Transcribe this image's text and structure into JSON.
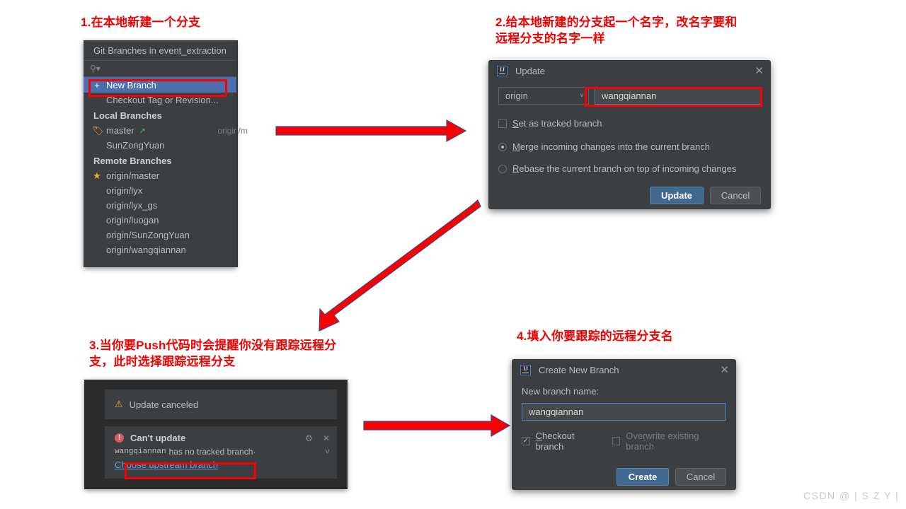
{
  "annotations": [
    {
      "id": "step1",
      "text": "1.在本地新建一个分支"
    },
    {
      "id": "step2",
      "text": "2.给本地新建的分支起一个名字，改名字要和\n远程分支的名字一样"
    },
    {
      "id": "step3",
      "text": "3.当你要Push代码时会提醒你没有跟踪远程分\n支，此时选择跟踪远程分支"
    },
    {
      "id": "step4",
      "text": "4.填入你要跟踪的远程分支名"
    }
  ],
  "git_branches_popup": {
    "title": "Git Branches in event_extraction",
    "search_placeholder": "",
    "search_icon": "search-icon",
    "actions": [
      {
        "label": "New Branch",
        "icon": "plus-icon",
        "selected": true
      },
      {
        "label": "Checkout Tag or Revision...",
        "icon": "",
        "selected": false
      }
    ],
    "local_header": "Local Branches",
    "local_branches": [
      {
        "label": "master",
        "icon": "tag-icon",
        "arrow": "↗",
        "tracked": "origin/m"
      },
      {
        "label": "SunZongYuan",
        "icon": "",
        "arrow": "",
        "tracked": ""
      }
    ],
    "remote_header": "Remote Branches",
    "remote_branches": [
      {
        "label": "origin/master",
        "icon": "star-icon"
      },
      {
        "label": "origin/lyx",
        "icon": ""
      },
      {
        "label": "origin/lyx_gs",
        "icon": ""
      },
      {
        "label": "origin/luogan",
        "icon": ""
      },
      {
        "label": "origin/SunZongYuan",
        "icon": ""
      },
      {
        "label": "origin/wangqiannan",
        "icon": ""
      }
    ]
  },
  "update_dialog": {
    "title": "Update",
    "app_icon": "intellij-idea-icon",
    "close_icon": "close-icon",
    "remote_value": "origin",
    "branch_value": "wangqiannan",
    "set_tracked_label": "Set as tracked branch",
    "set_tracked_checked": false,
    "merge_label": "Merge incoming changes into the current branch",
    "rebase_label": "Rebase the current branch on top of incoming changes",
    "selected_strategy": "merge",
    "ok_label": "Update",
    "cancel_label": "Cancel"
  },
  "notification_panel": {
    "canceled": {
      "icon": "warning-icon",
      "text": "Update canceled"
    },
    "error": {
      "icon": "error-icon",
      "title": "Can't update",
      "branch": "wangqiannan",
      "message": "has no tracked branch·",
      "link": "Choose upstream branch",
      "gear_icon": "gear-icon",
      "close_icon": "close-icon",
      "expand_icon": "chevron-down-icon"
    }
  },
  "create_branch_dialog": {
    "title": "Create New Branch",
    "app_icon": "intellij-idea-icon",
    "close_icon": "close-icon",
    "field_label": "New branch name:",
    "branch_value": "wangqiannan",
    "checkout_label": "Checkout branch",
    "checkout_checked": true,
    "overwrite_label": "Overwrite existing branch",
    "overwrite_checked": false,
    "ok_label": "Create",
    "cancel_label": "Cancel"
  },
  "watermark": "CSDN @ | S Z Y |",
  "colors": {
    "annotation_red": "#f20000",
    "highlight_red": "#fb0000",
    "arrow_red": "#fb0000",
    "selection_blue": "#4b6eaf",
    "primary_button": "#41688f",
    "panel_bg": "#3c3f41",
    "dark_bg": "#2b2b2b",
    "link_blue": "#6a9fe0"
  }
}
